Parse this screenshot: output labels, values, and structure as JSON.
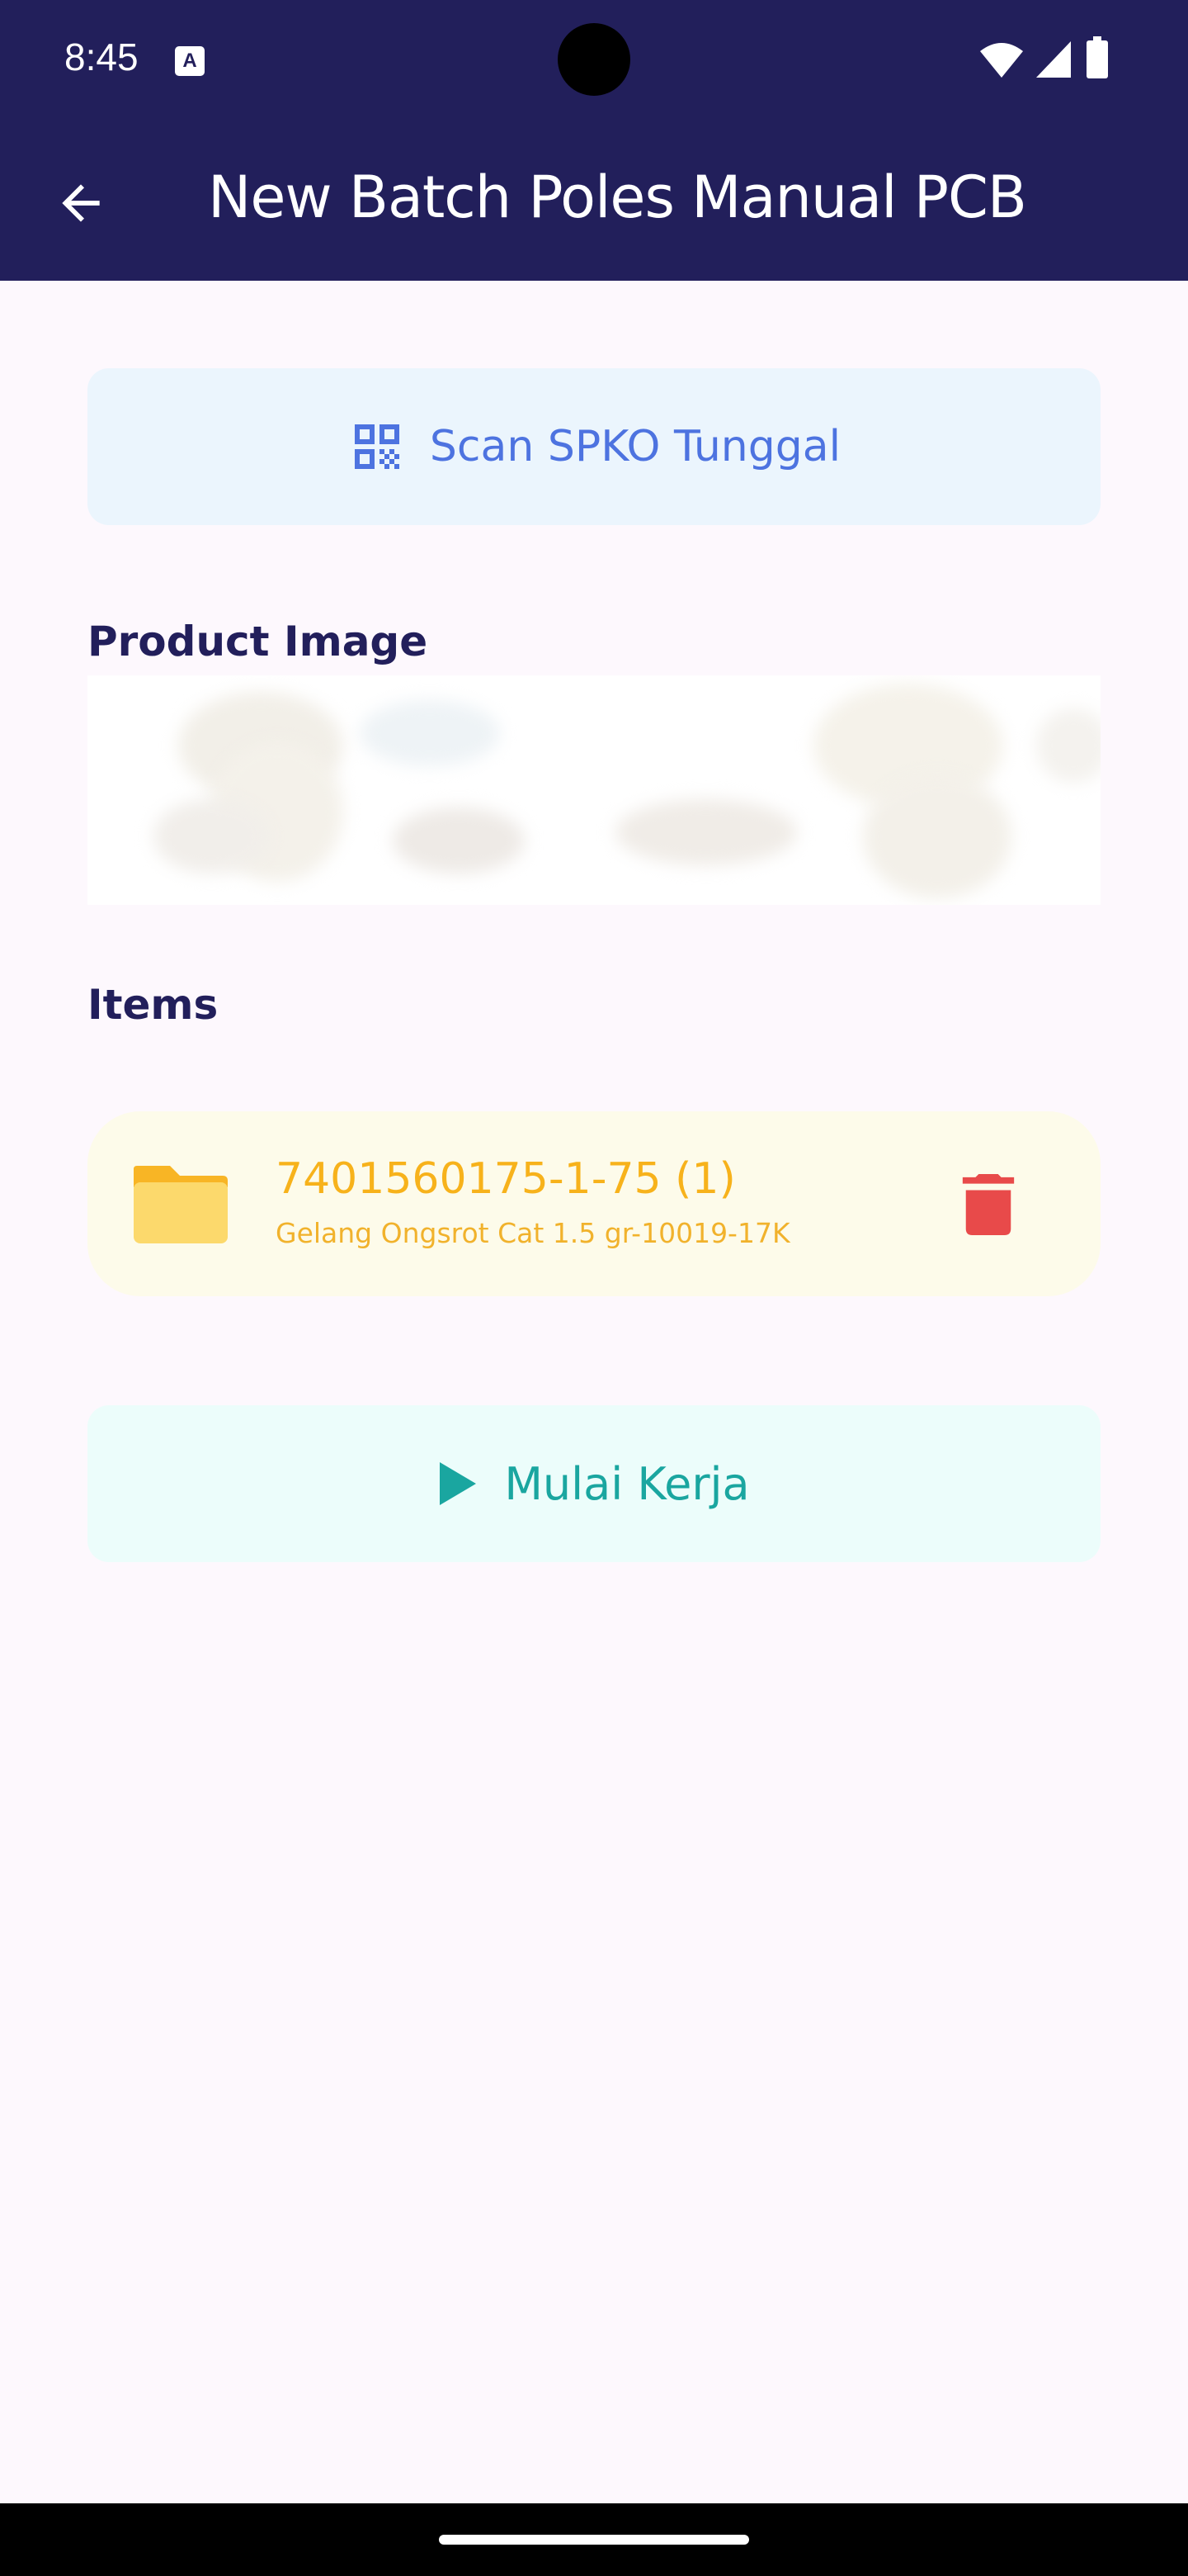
{
  "status_bar": {
    "time": "8:45",
    "notification_icon": "text-a-icon",
    "icons": [
      "wifi-icon",
      "signal-icon",
      "battery-icon"
    ]
  },
  "app_bar": {
    "title": "New Batch Poles Manual PCB",
    "back_icon": "arrow-back-icon"
  },
  "scan_button": {
    "label": "Scan SPKO Tunggal",
    "icon": "qr-code-icon"
  },
  "product_image": {
    "title": "Product Image"
  },
  "items": {
    "title": "Items",
    "list": [
      {
        "code": "7401560175-1-75 (1)",
        "description": "Gelang Ongsrot Cat 1.5 gr-10019-17K",
        "icon": "folder-icon",
        "action_icon": "trash-icon"
      }
    ]
  },
  "start_button": {
    "label": "Mulai Kerja",
    "icon": "play-icon"
  },
  "colors": {
    "header": "#221f5b",
    "background": "#fdf8fd",
    "scan_accent": "#4d73e0",
    "item_accent": "#f7b21b",
    "delete": "#e84a4a",
    "start_accent": "#1aa6a0"
  }
}
